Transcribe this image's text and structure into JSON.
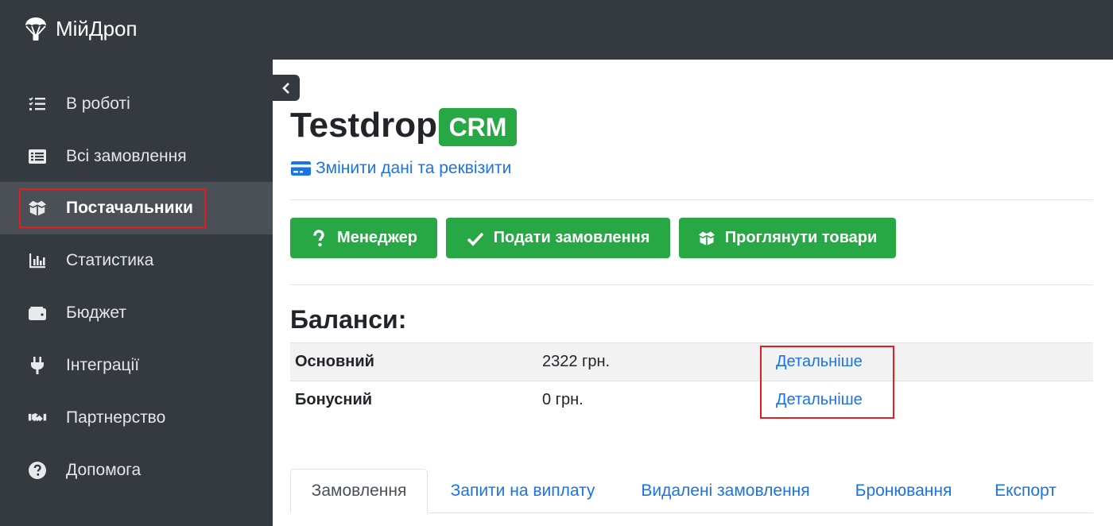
{
  "header": {
    "brand": "МійДроп",
    "brand_icon": "parachute-icon"
  },
  "sidebar": {
    "items": [
      {
        "label": "В роботі",
        "icon": "tasks-icon"
      },
      {
        "label": "Всі замовлення",
        "icon": "list-alt-icon"
      },
      {
        "label": "Постачальники",
        "icon": "box-open-icon",
        "active": true
      },
      {
        "label": "Статистика",
        "icon": "chart-bar-icon"
      },
      {
        "label": "Бюджет",
        "icon": "wallet-icon"
      },
      {
        "label": "Інтеграції",
        "icon": "plug-icon"
      },
      {
        "label": "Партнерство",
        "icon": "handshake-icon"
      },
      {
        "label": "Допомога",
        "icon": "question-circle-icon"
      }
    ]
  },
  "main": {
    "title": "Testdrop",
    "badge": "CRM",
    "edit_link": "Змінити дані та реквізити",
    "buttons": [
      {
        "label": "Менеджер",
        "icon": "question-icon"
      },
      {
        "label": "Подати замовлення",
        "icon": "check-icon"
      },
      {
        "label": "Проглянути товари",
        "icon": "box-open-icon"
      }
    ],
    "balances": {
      "title": "Баланси:",
      "rows": [
        {
          "name": "Основний",
          "amount": "2322 грн.",
          "link": "Детальніше"
        },
        {
          "name": "Бонусний",
          "amount": "0 грн.",
          "link": "Детальніше"
        }
      ]
    },
    "tabs": [
      {
        "label": "Замовлення",
        "active": true
      },
      {
        "label": "Запити на виплату"
      },
      {
        "label": "Видалені замовлення"
      },
      {
        "label": "Бронювання"
      },
      {
        "label": "Експорт"
      }
    ]
  },
  "colors": {
    "sidebar": "#343a40",
    "accent_green": "#28a745",
    "link_blue": "#1a73e8",
    "highlight_red": "#e02020"
  }
}
